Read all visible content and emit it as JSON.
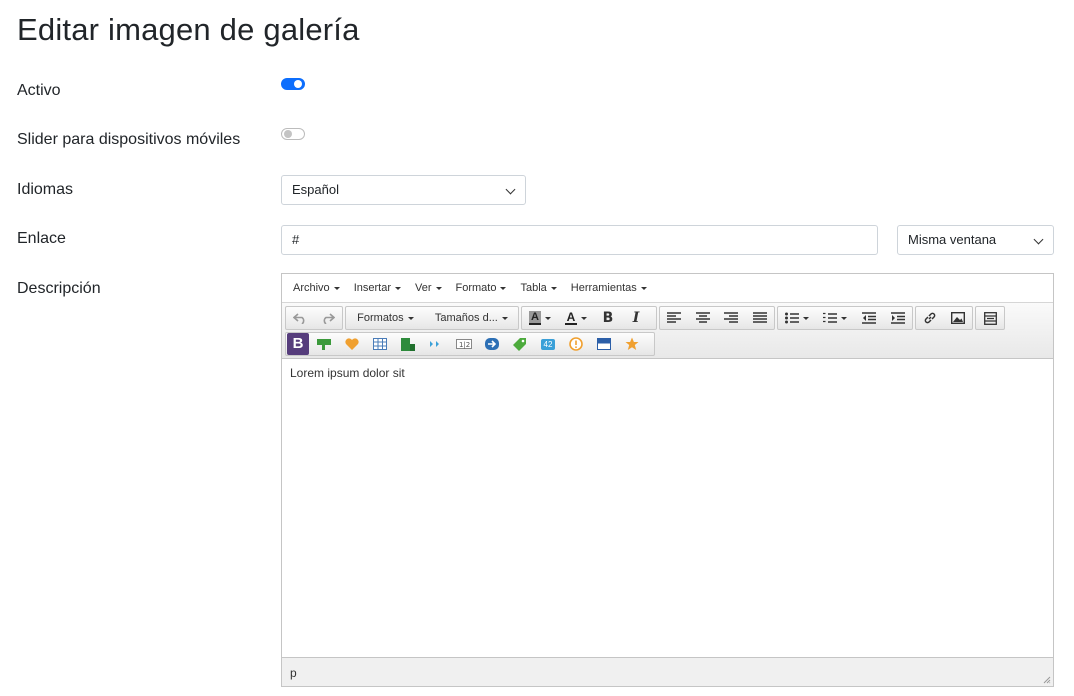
{
  "page": {
    "title": "Editar imagen de galería"
  },
  "form": {
    "activo": {
      "label": "Activo",
      "checked": true
    },
    "slider": {
      "label": "Slider para dispositivos móviles",
      "checked": false
    },
    "idiomas": {
      "label": "Idiomas",
      "value": "Español"
    },
    "enlace": {
      "label": "Enlace",
      "value": "#",
      "target": "Misma ventana"
    },
    "descripcion": {
      "label": "Descripción"
    }
  },
  "editor": {
    "menu": [
      "Archivo",
      "Insertar",
      "Ver",
      "Formato",
      "Tabla",
      "Herramientas"
    ],
    "formats_label": "Formatos",
    "sizes_label": "Tamaños d...",
    "content": "Lorem ipsum dolor sit",
    "status_path": "p",
    "plugin_icons": [
      "bootstrap-icon",
      "button-icon",
      "heart-icon",
      "table-grid-icon",
      "layout-icon",
      "breadcrumb-icon",
      "pagination-icon",
      "arrow-circle-icon",
      "tag-icon",
      "badge-icon",
      "alert-icon",
      "panel-icon",
      "star-icon"
    ]
  },
  "colors": {
    "accent": "#0d6efd",
    "bootstrap": "#563d7c"
  }
}
